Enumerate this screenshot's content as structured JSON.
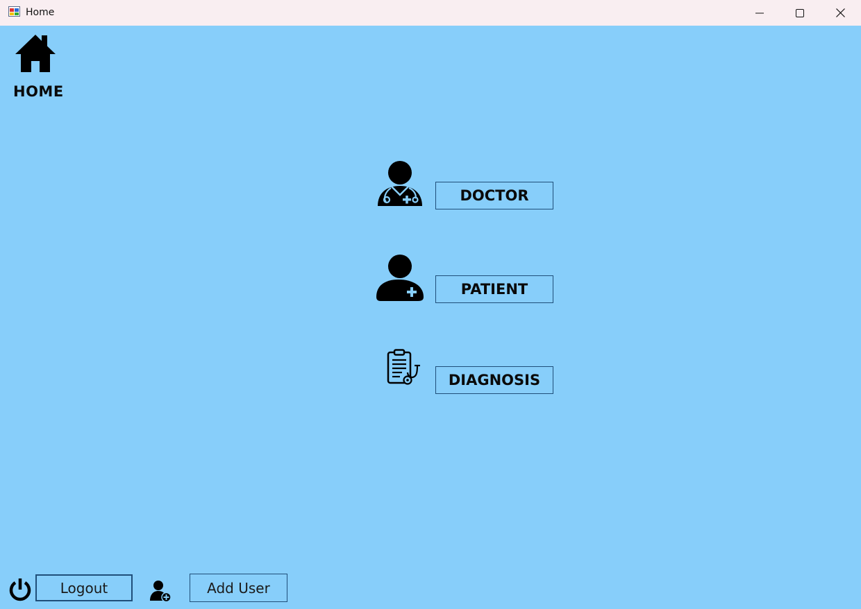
{
  "window": {
    "title": "Home",
    "background": "#87CEFA",
    "titlebar_color": "#F9EEF1"
  },
  "header": {
    "icon": "home-icon",
    "label": "HOME"
  },
  "menu": [
    {
      "icon": "doctor-icon",
      "label": "DOCTOR"
    },
    {
      "icon": "patient-icon",
      "label": "PATIENT"
    },
    {
      "icon": "diagnosis-icon",
      "label": "DIAGNOSIS"
    }
  ],
  "footer": {
    "logout_icon": "power-icon",
    "logout_label": "Logout",
    "adduser_icon": "add-user-icon",
    "adduser_label": "Add User"
  }
}
